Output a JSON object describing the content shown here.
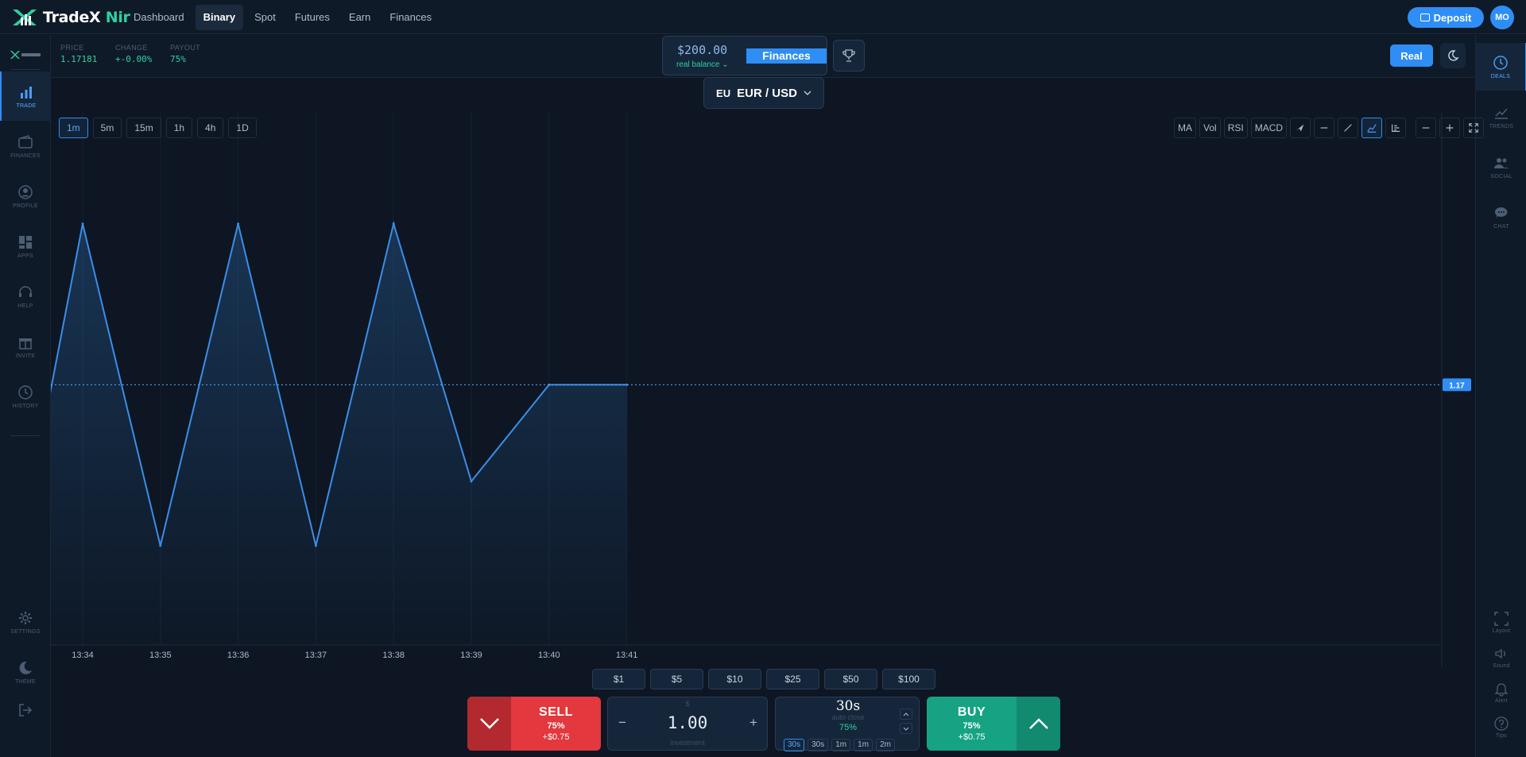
{
  "brand": {
    "name": "TradeX",
    "suffix": "Nir"
  },
  "nav": {
    "links": [
      {
        "label": "Dashboard",
        "active": false
      },
      {
        "label": "Binary",
        "active": true
      },
      {
        "label": "Spot",
        "active": false
      },
      {
        "label": "Futures",
        "active": false
      },
      {
        "label": "Earn",
        "active": false
      },
      {
        "label": "Finances",
        "active": false
      }
    ],
    "deposit_label": "Deposit",
    "avatar_initials": "MO"
  },
  "sidebar_left": {
    "items": [
      {
        "label": "TRADE",
        "icon": "bar-chart-icon",
        "active": true
      },
      {
        "label": "FINANCES",
        "icon": "wallet-icon",
        "active": false
      },
      {
        "label": "PROFILE",
        "icon": "user-circle-icon",
        "active": false
      },
      {
        "label": "APPS",
        "icon": "grid-icon",
        "active": false
      },
      {
        "label": "HELP",
        "icon": "headset-icon",
        "active": false
      },
      {
        "label": "INVITE",
        "icon": "gift-icon",
        "active": false
      },
      {
        "label": "HISTORY",
        "icon": "clock-icon",
        "active": false
      }
    ],
    "bottom_items": [
      {
        "label": "SETTINGS",
        "icon": "gear-icon"
      },
      {
        "label": "THEME",
        "icon": "moon-icon"
      }
    ]
  },
  "sidebar_right": {
    "items": [
      {
        "label": "DEALS",
        "icon": "clock-icon",
        "active": true
      },
      {
        "label": "TRENDS",
        "icon": "trend-icon",
        "active": false
      },
      {
        "label": "SOCIAL",
        "icon": "users-icon",
        "active": false
      },
      {
        "label": "CHAT",
        "icon": "chat-icon",
        "active": false
      }
    ],
    "bottom_items": [
      {
        "label": "Layout",
        "icon": "layout-icon"
      },
      {
        "label": "Sound",
        "icon": "speaker-icon"
      },
      {
        "label": "Alert",
        "icon": "bell-icon"
      },
      {
        "label": "Tips",
        "icon": "help-icon"
      }
    ]
  },
  "stats": {
    "price_label": "PRICE",
    "price_value": "1.17181",
    "change_label": "CHANGE",
    "change_value": "+-0.00%",
    "payout_label": "PAYOUT",
    "payout_value": "75%"
  },
  "balance": {
    "amount": "$200.00",
    "sub": "real balance",
    "finances_label": "Finances"
  },
  "account": {
    "mode_label": "Real"
  },
  "pair": {
    "flag": "EU",
    "name": "EUR / USD"
  },
  "timeframes": [
    {
      "label": "1m",
      "active": true
    },
    {
      "label": "5m",
      "active": false
    },
    {
      "label": "15m",
      "active": false
    },
    {
      "label": "1h",
      "active": false
    },
    {
      "label": "4h",
      "active": false
    },
    {
      "label": "1D",
      "active": false
    }
  ],
  "chart_tools": [
    "MA",
    "Vol",
    "RSI",
    "MACD"
  ],
  "chart_data": {
    "type": "area",
    "x": [
      "13:34",
      "13:35",
      "13:36",
      "13:37",
      "13:38",
      "13:39",
      "13:40",
      "13:41"
    ],
    "series": [
      {
        "values": [
          1.22,
          1.12,
          1.22,
          1.12,
          1.22,
          1.14,
          1.17,
          1.17
        ]
      }
    ],
    "start_value": 1.166,
    "current_price_label": "1.17",
    "current_price": 1.17,
    "ylim": [
      1.1,
      1.235
    ],
    "color": "#3a8ee8",
    "grid": true
  },
  "quick_amounts": [
    "$1",
    "$5",
    "$10",
    "$25",
    "$50",
    "$100"
  ],
  "trade": {
    "sell_label": "SELL",
    "sell_payout": "75%",
    "sell_gain": "+$0.75",
    "buy_label": "BUY",
    "buy_payout": "75%",
    "buy_gain": "+$0.75",
    "currency": "$",
    "investment_value": "1.00",
    "investment_label": "investment",
    "minus": "−",
    "plus": "+",
    "timer_value": "30s",
    "auto_close_label": "auto close",
    "timer_payout": "75%",
    "durations": [
      {
        "label": "30s",
        "active": true
      },
      {
        "label": "30s",
        "active": false
      },
      {
        "label": "1m",
        "active": false
      },
      {
        "label": "1m",
        "active": false
      },
      {
        "label": "2m",
        "active": false
      }
    ]
  }
}
